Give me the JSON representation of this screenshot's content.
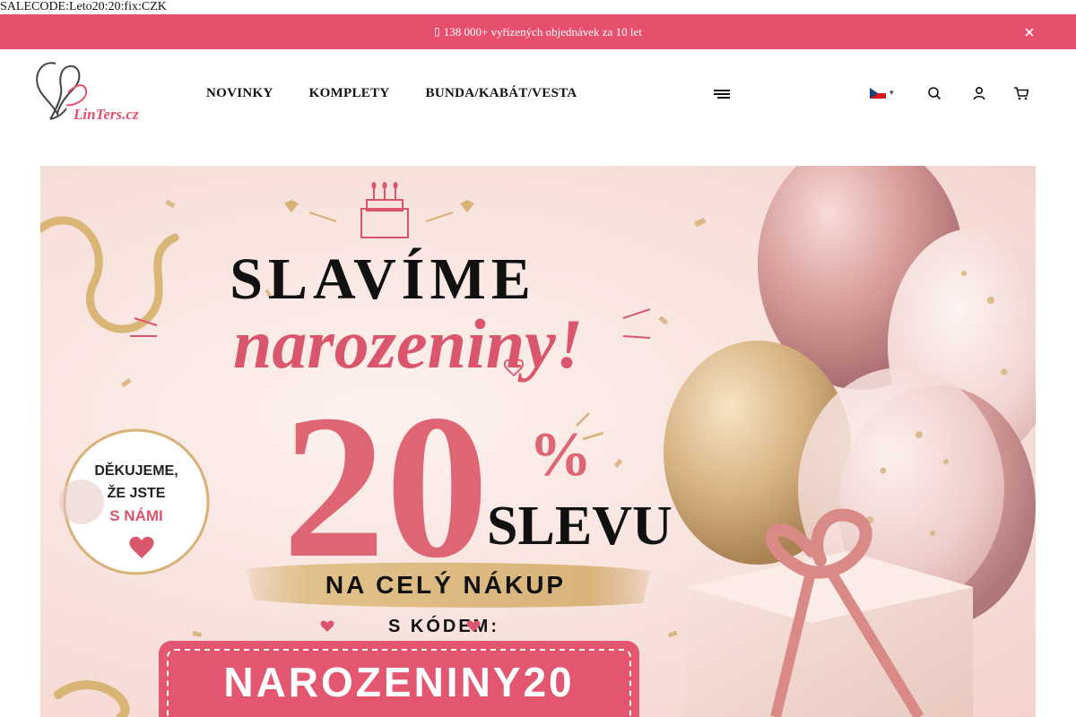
{
  "salecode": "SALECODE:Leto20:20:fix:CZK",
  "announcement": {
    "icon": "truck-icon",
    "text": "138 000+ vyřízených objednávek za 10 let"
  },
  "logo": {
    "text": "LinTers.cz"
  },
  "nav": {
    "items": [
      "NOVINKY",
      "KOMPLETY",
      "BUNDA/KABÁT/VESTA"
    ]
  },
  "banner": {
    "title_line1": "SLAVÍME",
    "title_line2": "narozeniny!",
    "big_number": "20",
    "percent": "%",
    "slevu": "SLEVU",
    "subtitle": "NA CELÝ NÁKUP",
    "code_label": "S KÓDEM:",
    "code": "NAROZENINY20",
    "badge_line1": "DĚKUJEME,",
    "badge_line2": "ŽE JSTE",
    "badge_line3": "S NÁMI"
  },
  "colors": {
    "accent": "#e6506e",
    "banner_pink": "#d9566c",
    "gold": "#c9a35a"
  }
}
